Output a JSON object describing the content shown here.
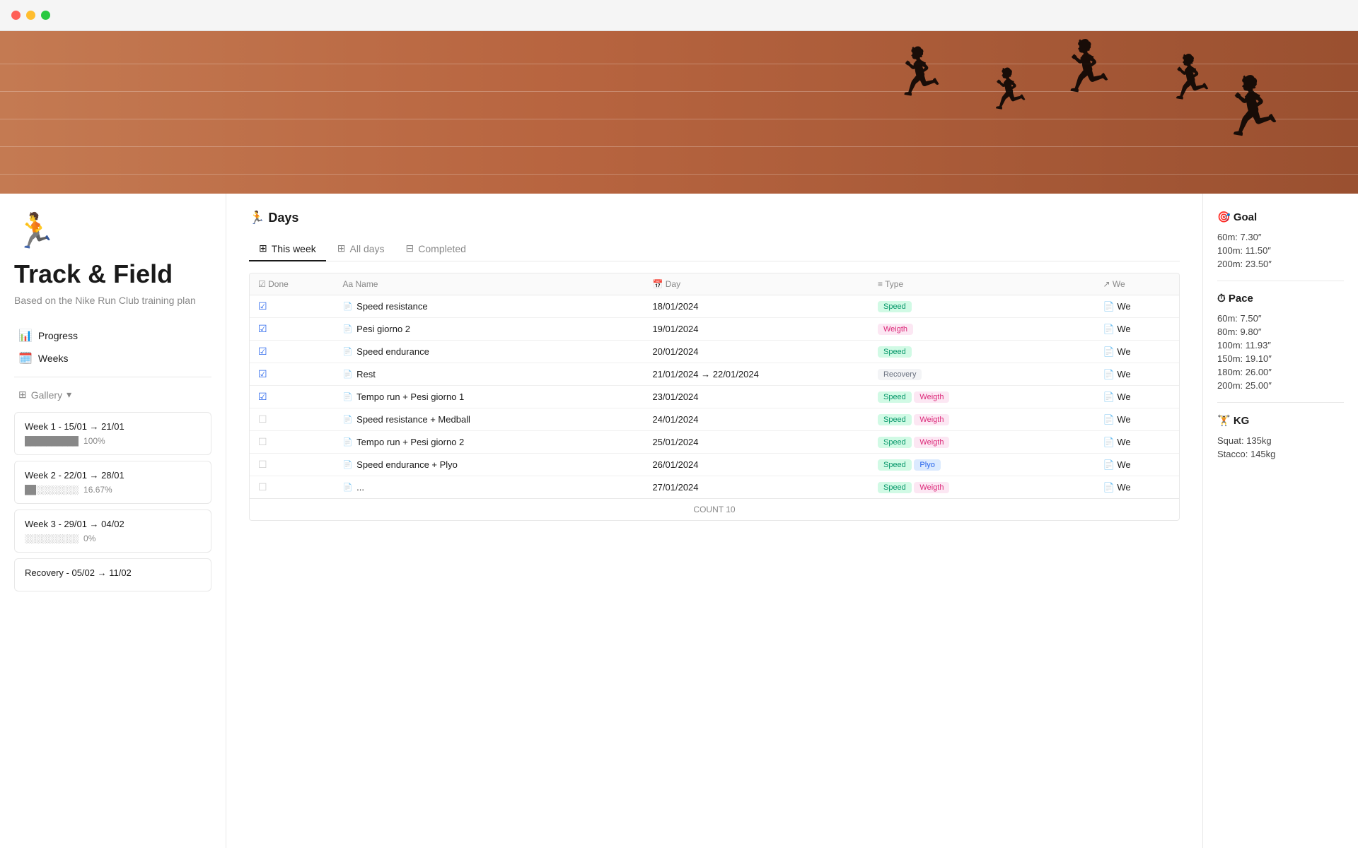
{
  "window": {
    "dots": [
      "red",
      "yellow",
      "green"
    ]
  },
  "page": {
    "icon": "🏃",
    "title": "Track & Field",
    "subtitle": "Based on the Nike Run Club training plan"
  },
  "sidebar": {
    "nav": [
      {
        "icon": "📊",
        "label": "Progress"
      },
      {
        "icon": "🗓️",
        "label": "Weeks"
      }
    ],
    "gallery_label": "Gallery",
    "weeks": [
      {
        "title": "Week 1 - 15/01 → 21/01",
        "progress_chars": "██████████",
        "pct": "100%"
      },
      {
        "title": "Week 2 - 22/01 → 28/01",
        "progress_chars": "██░░░░░░░░",
        "pct": "16.67%"
      },
      {
        "title": "Week 3 - 29/01 → 04/02",
        "progress_chars": "░░░░░░░░░░",
        "pct": "0%"
      },
      {
        "title": "Recovery - 05/02 → 11/02",
        "progress_chars": "",
        "pct": ""
      }
    ]
  },
  "main": {
    "section_title": "🏃 Days",
    "tabs": [
      {
        "icon": "⊞",
        "label": "This week",
        "active": true
      },
      {
        "icon": "⊞",
        "label": "All days",
        "active": false
      },
      {
        "icon": "⊟",
        "label": "Completed",
        "active": false
      }
    ],
    "table": {
      "headers": [
        "Done",
        "Name",
        "Day",
        "Type",
        "We"
      ],
      "rows": [
        {
          "done": true,
          "name": "Speed resistance",
          "day": "18/01/2024",
          "type": "Speed",
          "type2": null,
          "we": "We"
        },
        {
          "done": true,
          "name": "Pesi giorno 2",
          "day": "19/01/2024",
          "type": "Weigth",
          "type2": null,
          "we": "We"
        },
        {
          "done": true,
          "name": "Speed endurance",
          "day": "20/01/2024",
          "type": "Speed",
          "type2": null,
          "we": "We"
        },
        {
          "done": true,
          "name": "Rest",
          "day": "21/01/2024 → 22/01/2024",
          "type": "Recovery",
          "type2": null,
          "we": "We"
        },
        {
          "done": true,
          "name": "Tempo run + Pesi giorno 1",
          "day": "23/01/2024",
          "type": "Speed",
          "type2": "Weigth",
          "we": "We"
        },
        {
          "done": false,
          "name": "Speed resistance + Medball",
          "day": "24/01/2024",
          "type": "Speed",
          "type2": "Weigth",
          "we": "We"
        },
        {
          "done": false,
          "name": "Tempo run + Pesi giorno 2",
          "day": "25/01/2024",
          "type": "Speed",
          "type2": "Weigth",
          "we": "We"
        },
        {
          "done": false,
          "name": "Speed endurance + Plyo",
          "day": "26/01/2024",
          "type": "Speed",
          "type2": "Plyo",
          "we": "We"
        },
        {
          "done": false,
          "name": "...",
          "day": "27/01/2024",
          "type": "Speed",
          "type2": "Weigth",
          "we": "We"
        }
      ],
      "count_label": "COUNT",
      "count_value": "10"
    }
  },
  "right_panel": {
    "title": "🎯 Goal",
    "goal_stats": [
      "60m: 7.30″",
      "100m: 11.50″",
      "200m: 23.50″"
    ],
    "pace_title": "⏱ Pace",
    "pace_stats": [
      "60m: 7.50″",
      "80m: 9.80″",
      "100m: 11.93″",
      "150m: 19.10″",
      "180m: 26.00″",
      "200m: 25.00″"
    ],
    "kg_title": "🏋️ KG",
    "kg_stats": [
      "Squat: 135kg",
      "Stacco: 145kg"
    ]
  }
}
